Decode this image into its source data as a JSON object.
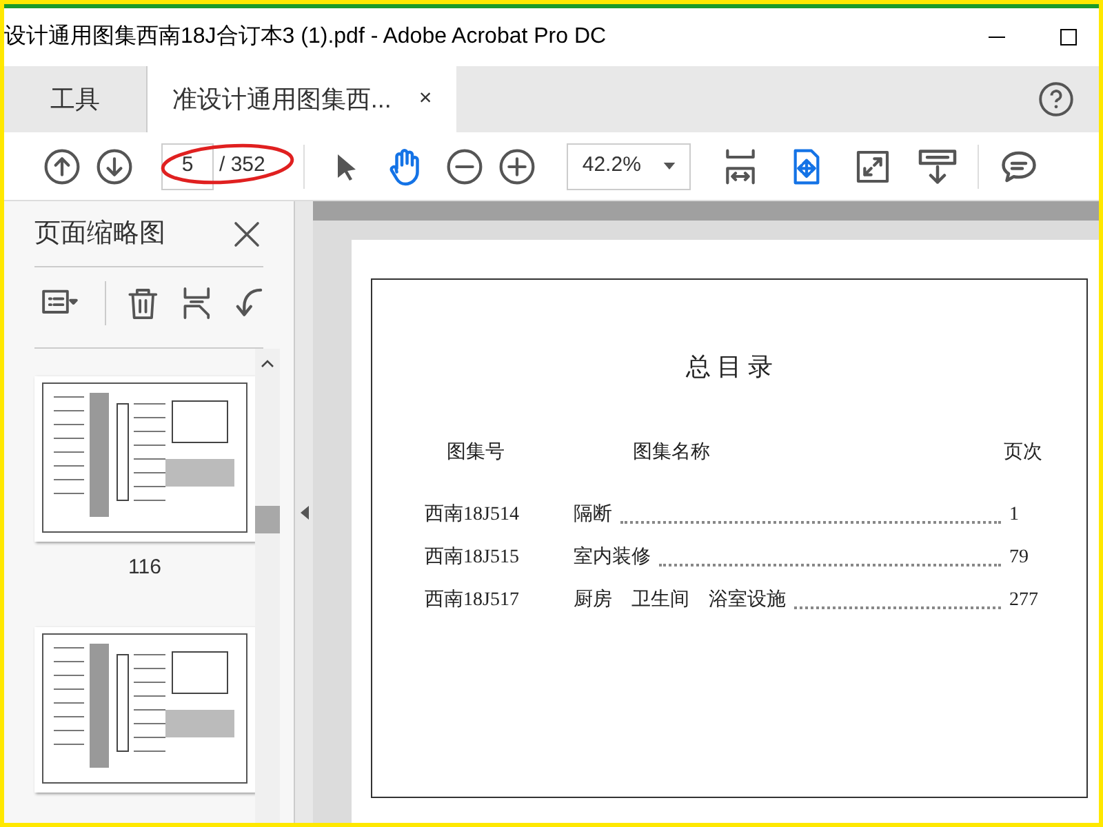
{
  "window": {
    "title": "设计通用图集西南18J合订本3 (1).pdf - Adobe Acrobat Pro DC"
  },
  "tabs": [
    {
      "label": "工具",
      "selected": false,
      "closable": false
    },
    {
      "label": "准设计通用图集西...",
      "selected": true,
      "closable": true,
      "close_glyph": "×"
    }
  ],
  "toolbar": {
    "page_value": "5",
    "page_total": "/ 352",
    "zoom": "42.2%",
    "hand_tool_selected": true
  },
  "side_panel": {
    "title": "页面缩略图",
    "thumbnails": [
      {
        "kind": "labeled",
        "label": "116"
      },
      {
        "kind": "unlabeled"
      }
    ]
  },
  "document": {
    "heading": "总 目 录",
    "columns": [
      "图集号",
      "图集名称",
      "页次"
    ],
    "rows": [
      {
        "code": "西南18J514",
        "name": "隔断",
        "page": "1"
      },
      {
        "code": "西南18J515",
        "name": "室内装修",
        "page": "79"
      },
      {
        "code": "西南18J517",
        "name": "厨房　卫生间　浴室设施",
        "page": "277"
      }
    ]
  }
}
